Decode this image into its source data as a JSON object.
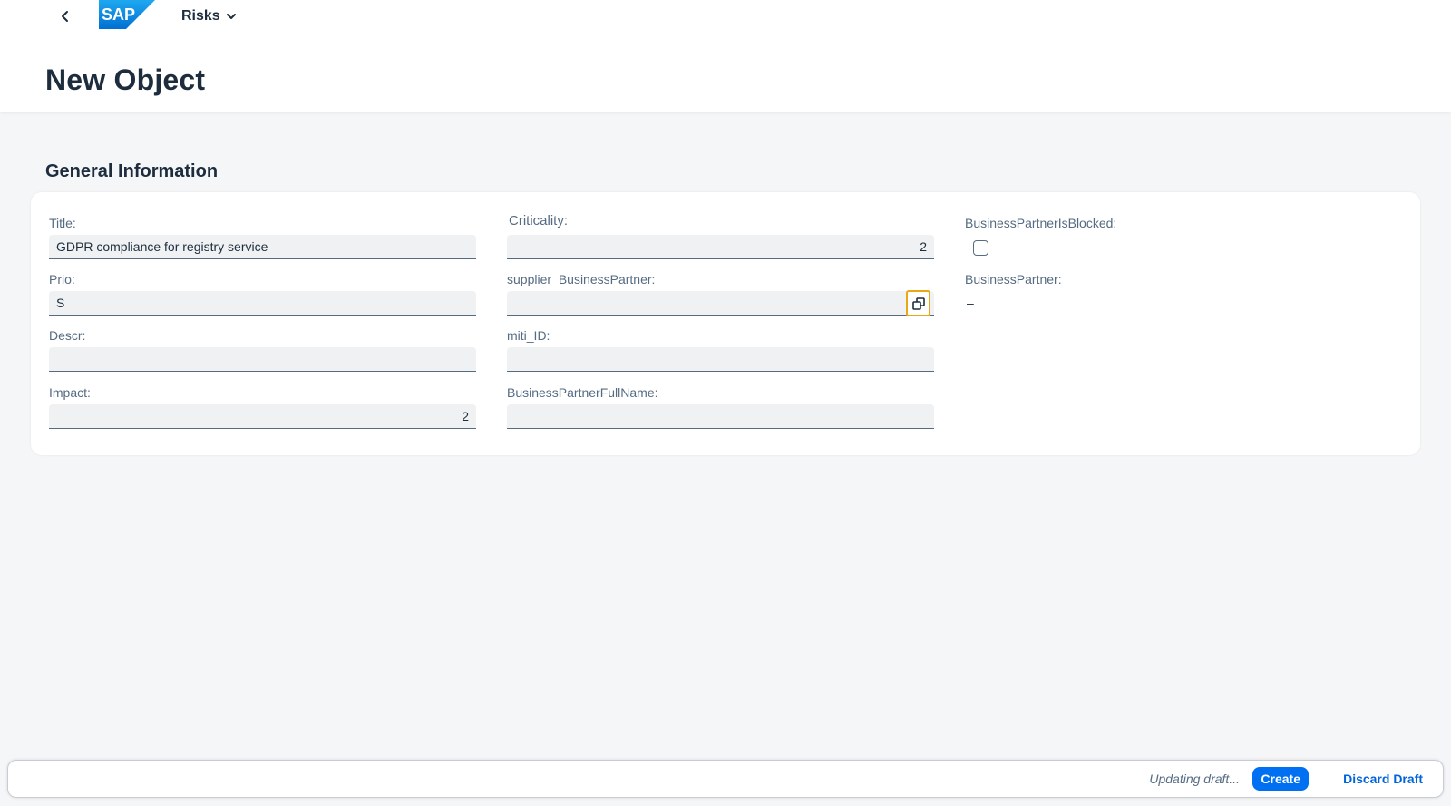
{
  "shell": {
    "app_title": "Risks",
    "logo_text": "SAP",
    "brand_color": "#0070f2"
  },
  "page": {
    "title": "New Object"
  },
  "section": {
    "title": "General Information"
  },
  "fields": {
    "title": {
      "label": "Title:",
      "value": "GDPR compliance for registry service"
    },
    "prio": {
      "label": "Prio:",
      "value": "S"
    },
    "descr": {
      "label": "Descr:",
      "value": ""
    },
    "impact": {
      "label": "Impact:",
      "value": "2"
    },
    "criticality": {
      "label": "Criticality:",
      "value": "2"
    },
    "supplier_bp": {
      "label": "supplier_BusinessPartner:",
      "value": ""
    },
    "miti_id": {
      "label": "miti_ID:",
      "value": ""
    },
    "bp_fullname": {
      "label": "BusinessPartnerFullName:",
      "value": ""
    },
    "bp_is_blocked": {
      "label": "BusinessPartnerIsBlocked:",
      "checked": false
    },
    "business_partner": {
      "label": "BusinessPartner:",
      "value": "–"
    }
  },
  "footer": {
    "status": "Updating draft...",
    "create_label": "Create",
    "discard_label": "Discard Draft"
  },
  "icons": {
    "back": "chevron-left-icon",
    "menu": "chevron-down-icon",
    "value_help": "value-help-icon"
  }
}
